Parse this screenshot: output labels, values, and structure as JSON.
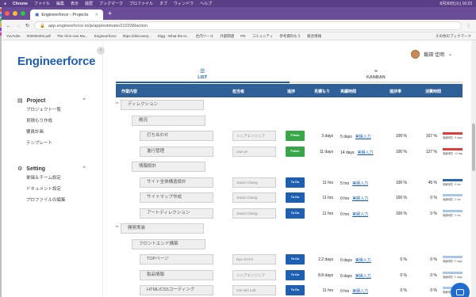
{
  "macbar": {
    "apple": "",
    "app": "Chrome",
    "menus": [
      "ファイル",
      "編集",
      "表示",
      "履歴",
      "ブックマーク",
      "プロファイル",
      "タブ",
      "ウィンドウ",
      "ヘルプ"
    ],
    "clock": "8月30日(火) 16:23"
  },
  "browser": {
    "tab_title": "Engineerforce - Projects",
    "url": "app.engineerforce.io/ja/app/estimate/210338/action",
    "bookmarks": [
      "YouTube",
      "000005394.pdf",
      "The All-in-one Ma...",
      "Engineerforce",
      "https://discovery...",
      "Digg - What the In...",
      "社内ツール",
      "外部関連",
      "PR",
      "コミュニティ",
      "参考資料もう",
      "競合情報"
    ],
    "bookmarks_right": "その他のブックマーク"
  },
  "sidebar": {
    "logo": "Engineerforce",
    "collapse": "‹",
    "sections": [
      {
        "title": "Project",
        "items": [
          "プロジェクト一覧",
          "見積もり作成",
          "要員計画",
          "テンプレート"
        ]
      },
      {
        "title": "Setting",
        "items": [
          "単価＆チーム設定",
          "ドキュメント設定",
          "プロファイルの編集"
        ]
      }
    ]
  },
  "user": {
    "name": "飯田 佳明"
  },
  "tabs": [
    {
      "label": "LIST",
      "icon": "list-icon"
    },
    {
      "label": "KANBAN",
      "icon": "kanban-icon"
    }
  ],
  "table": {
    "headers": {
      "name": "作業内容",
      "assignee": "担当者",
      "status": "進捗",
      "estimate": "見積もり",
      "actual": "実績時間",
      "progress": "進捗率",
      "consumption": "消費時間"
    },
    "rows": [
      {
        "toggle": "^",
        "level": 0,
        "name": "ディレクション"
      },
      {
        "level": 1,
        "name": "概況"
      },
      {
        "level": 2,
        "name": "打ち合わせ",
        "assignee": "シニアエンジニア",
        "status": "Finish",
        "estimate": "3 days",
        "actual": "5 days",
        "link": "実績入力",
        "progress": "100 %",
        "consumption": "167 %",
        "bar_color": "#e03c3c",
        "bar_label": "実績時間 : 5 days"
      },
      {
        "level": 2,
        "name": "進行管理",
        "assignee": "zaw ye",
        "status": "Finish",
        "estimate": "11 days",
        "actual": "14 days",
        "link": "実績入力",
        "progress": "100 %",
        "consumption": "127 %",
        "bar_color": "#e03c3c",
        "bar_label": "実績時間 : 14 days"
      },
      {
        "level": 1,
        "name": "情報設計"
      },
      {
        "level": 2,
        "name": "サイト全体構造設計",
        "assignee": "Jason Chang",
        "status": "To Do",
        "estimate": "11 hrs",
        "actual": "5 hrs",
        "link": "実績入力",
        "progress": "100 %",
        "consumption": "45 %",
        "bar_color": "#2c66b8",
        "bar_label": "実績時間 : 5 hrs"
      },
      {
        "level": 2,
        "name": "サイトマップ作成",
        "assignee": "Jason Chang",
        "status": "To Do",
        "estimate": "11 hrs",
        "actual": "0 hrs",
        "link": "実績入力",
        "progress": "100 %",
        "consumption": "0 %",
        "bar_color": "#a8c6ea",
        "bar_label": "実績時間 : 0 hrs"
      },
      {
        "level": 2,
        "name": "アートディレクション",
        "assignee": "Jason Chang",
        "status": "To Do",
        "estimate": "11 hrs",
        "actual": "0 hrs",
        "link": "実績入力",
        "progress": "100 %",
        "consumption": "0 %",
        "bar_color": "#a8c6ea",
        "bar_label": "実績時間 : 0 hrs"
      },
      {
        "toggle": "^",
        "level": 0,
        "name": "開発実装"
      },
      {
        "level": 1,
        "name": "フロントエンド構築"
      },
      {
        "level": 2,
        "name": "TOPページ",
        "assignee": "Ryo SATO",
        "status": "To Do",
        "estimate": "2.2 days",
        "actual": "0 days",
        "link": "実績入力",
        "progress": "0 %",
        "consumption": "0 %",
        "bar_color": "#a8c6ea",
        "bar_label": "実績時間 : 0 days"
      },
      {
        "level": 2,
        "name": "製品情報",
        "assignee": "シニアエンジニア",
        "status": "To Do",
        "estimate": "8.8 days",
        "actual": "0 days",
        "link": "実績入力",
        "progress": "0 %",
        "consumption": "0 %",
        "bar_color": "#a8c6ea",
        "bar_label": "実績時間 : 0 days"
      },
      {
        "level": 2,
        "name": "HTML/CSSコーディング",
        "assignee": "min min Latt",
        "status": "To Do",
        "estimate": "11 hrs",
        "actual": "0 hrs",
        "link": "実績入力",
        "progress": "0 %",
        "consumption": "0 %",
        "bar_color": "#a8c6ea",
        "bar_label": "実績時間 : 0 hrs"
      }
    ]
  },
  "colors": {
    "finish": "#3aa64a",
    "todo": "#1f5fb2",
    "header": "#2f5f97",
    "accent": "#1f5fb2"
  }
}
